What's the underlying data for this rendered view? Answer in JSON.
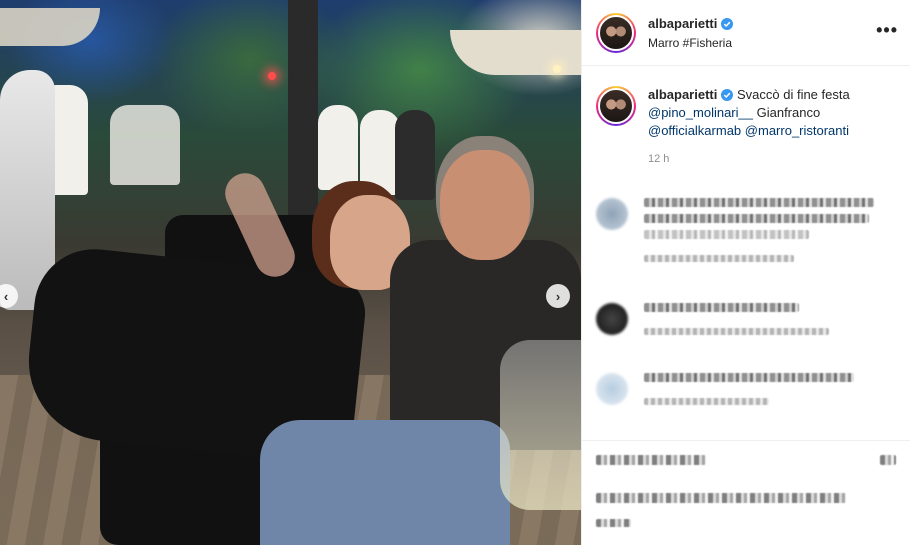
{
  "post": {
    "username": "albaparietti",
    "location": "Marro #Fisheria",
    "caption_text": "Svaccò di fine festa",
    "mentions": [
      "@pino_molinari__",
      "@officialkarmab",
      "@marro_ristoranti"
    ],
    "caption_name": "Gianfranco",
    "time": "12 h"
  },
  "icons": {
    "verified": "verified-badge-icon",
    "more": "more-options-icon",
    "prev": "chevron-left-icon",
    "next": "chevron-right-icon"
  },
  "glyphs": {
    "more": "•••",
    "prev": "‹",
    "next": "›"
  },
  "colors": {
    "verified": "#3897f0",
    "mention": "#00376b",
    "muted": "#8e8e8e"
  }
}
